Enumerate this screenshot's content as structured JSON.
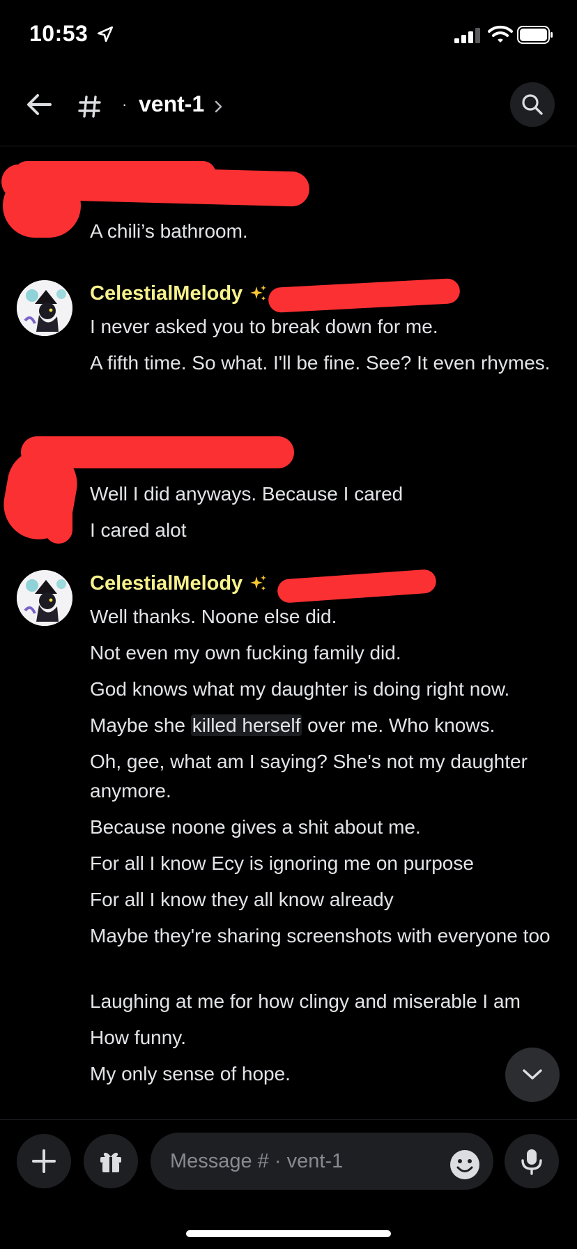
{
  "status_bar": {
    "time": "10:53"
  },
  "header": {
    "channel_dot": "·",
    "channel_name": "vent-1",
    "back_icon": "arrow-left-icon",
    "channel_icon": "hash-icon",
    "search_icon": "search-icon"
  },
  "messages": {
    "group_1": {
      "lines": [
        "A chili’s bathroom."
      ]
    },
    "group_2": {
      "author": "CelestialMelody",
      "lines": [
        "I never asked you to break down for me.",
        "A fifth time. So what. I'll be fine. See? It even rhymes."
      ]
    },
    "group_3": {
      "lines": [
        "Well I did anyways. Because I cared",
        "I cared alot"
      ]
    },
    "group_4": {
      "author": "CelestialMelody",
      "line_1": "Well thanks. Noone else did.",
      "line_2": "Not even my own fucking family did.",
      "line_3": "God knows what my daughter is doing right now.",
      "line_4_before": "Maybe she ",
      "line_4_highlight": "killed herself",
      "line_4_after": " over me. Who knows.",
      "line_5": "Oh, gee, what am I saying? She's not my daughter anymore.",
      "line_6": "Because noone gives a shit about me.",
      "line_7": "For all I know Ecy is ignoring me on purpose",
      "line_8": "For all I know they all know already",
      "line_9": "Maybe they're sharing screenshots with everyone too",
      "line_10": "Laughing at me for how clingy and miserable I am",
      "line_11": "How funny.",
      "line_12": "My only sense of hope."
    }
  },
  "composer": {
    "placeholder": "Message # · vent-1",
    "add_icon": "plus-icon",
    "gift_icon": "gift-icon",
    "emoji_icon": "emoji-icon",
    "mic_icon": "microphone-icon"
  },
  "colors": {
    "background": "#000000",
    "username": "#f7f28c",
    "redaction": "#fb3033",
    "surface": "#1e1f22"
  }
}
